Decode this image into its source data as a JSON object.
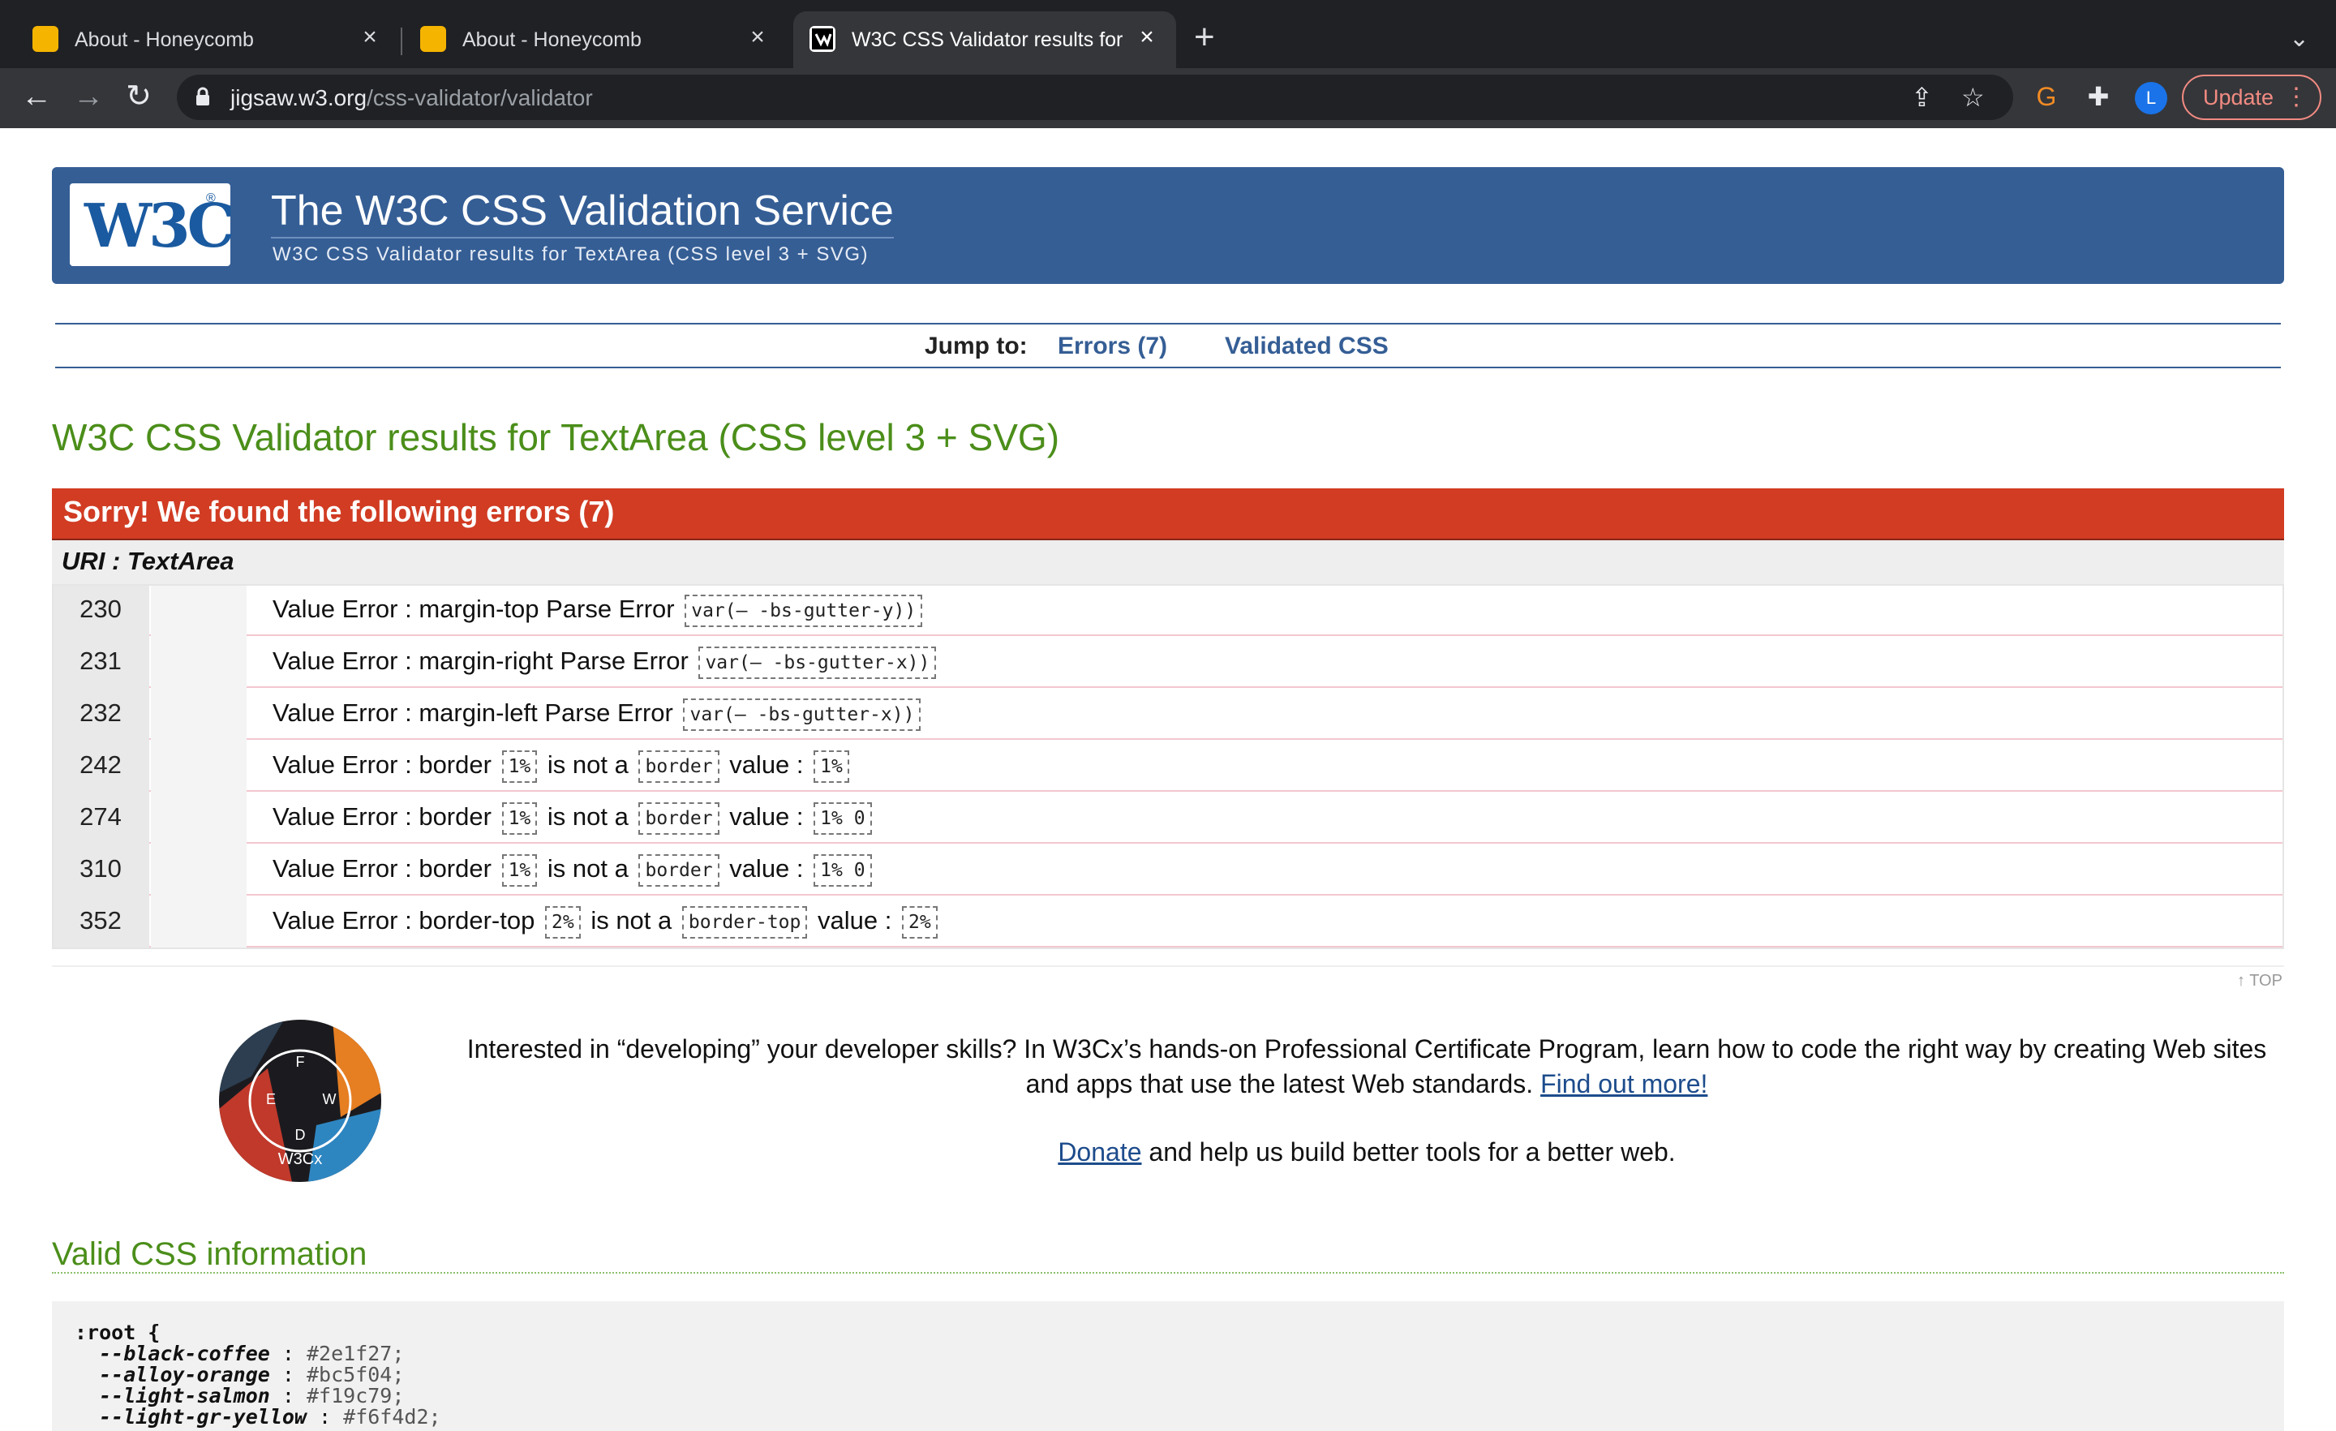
{
  "browser": {
    "tabs": [
      {
        "title": "About - Honeycomb",
        "active": false
      },
      {
        "title": "About - Honeycomb",
        "active": false
      },
      {
        "title": "W3C CSS Validator results for TextArea",
        "active": true
      }
    ],
    "new_tab": "+",
    "url_host": "jigsaw.w3.org",
    "url_path": "/css-validator/validator",
    "profile_initial": "L",
    "update_label": "Update"
  },
  "banner": {
    "logo": "W3C",
    "title": "The W3C CSS Validation Service",
    "subtitle": "W3C CSS Validator results for TextArea (CSS level 3 + SVG)"
  },
  "jump": {
    "label": "Jump to:",
    "links": [
      "Errors (7)",
      "Validated CSS"
    ]
  },
  "results_title": "W3C CSS Validator results for TextArea (CSS level 3 + SVG)",
  "errors": {
    "heading": "Sorry! We found the following errors (7)",
    "uri": "URI : TextArea",
    "rows": [
      {
        "line": "230",
        "prefix": "Value Error : margin-top Parse Error",
        "code1": "var(– -bs-gutter-y))"
      },
      {
        "line": "231",
        "prefix": "Value Error : margin-right Parse Error",
        "code1": "var(– -bs-gutter-x))"
      },
      {
        "line": "232",
        "prefix": "Value Error : margin-left Parse Error",
        "code1": "var(– -bs-gutter-x))"
      },
      {
        "line": "242",
        "prefix": "Value Error : border",
        "code1": "1%",
        "mid": "is not a",
        "code2": "border",
        "suffix": "value :",
        "code3": "1%"
      },
      {
        "line": "274",
        "prefix": "Value Error : border",
        "code1": "1%",
        "mid": "is not a",
        "code2": "border",
        "suffix": "value :",
        "code3": "1% 0"
      },
      {
        "line": "310",
        "prefix": "Value Error : border",
        "code1": "1%",
        "mid": "is not a",
        "code2": "border",
        "suffix": "value :",
        "code3": "1% 0"
      },
      {
        "line": "352",
        "prefix": "Value Error : border-top",
        "code1": "2%",
        "mid": "is not a",
        "code2": "border-top",
        "suffix": "value :",
        "code3": "2%"
      }
    ]
  },
  "top_link": "↑ TOP",
  "promo": {
    "text": "Interested in “developing” your developer skills? In W3Cx’s hands-on Professional Certificate Program, learn how to code the right way by creating Web sites and apps that use the latest Web standards.",
    "link": "Find out more!",
    "donate_link": "Donate",
    "donate_text": "and help us build better tools for a better web.",
    "badge_text": "W3Cx"
  },
  "valid_css": {
    "title": "Valid CSS information",
    "selector": ":root {",
    "declarations": [
      {
        "prop": "--black-coffee",
        "value": "#2e1f27;"
      },
      {
        "prop": "--alloy-orange",
        "value": "#bc5f04;"
      },
      {
        "prop": "--light-salmon",
        "value": "#f19c79;"
      },
      {
        "prop": "--light-gr-yellow",
        "value": "#f6f4d2;"
      }
    ]
  }
}
